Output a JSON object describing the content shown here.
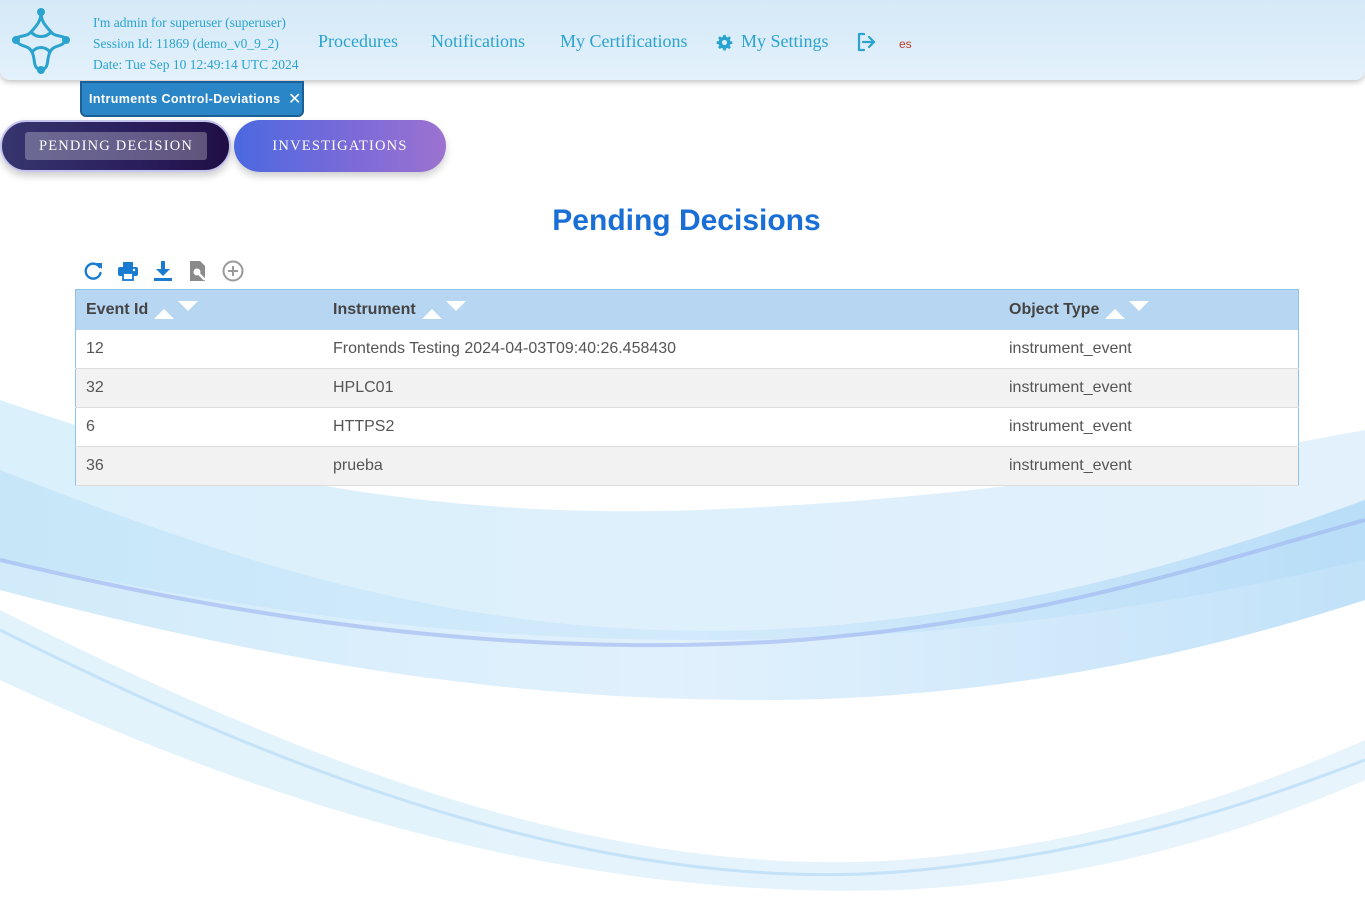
{
  "session": {
    "user_line": "I'm admin for superuser (superuser)",
    "session_line": "Session Id: 11869 (demo_v0_9_2)",
    "date_line": "Date: Tue Sep 10 12:49:14 UTC 2024"
  },
  "nav": {
    "procedures": "Procedures",
    "notifications": "Notifications",
    "certifications": "My Certifications",
    "settings": "My Settings",
    "language": "es"
  },
  "procedure_tab": {
    "label": "Intruments Control-Deviations",
    "close": "✕"
  },
  "view_tabs": {
    "pending": "PENDING DECISION",
    "investigations": "INVESTIGATIONS"
  },
  "page_title": "Pending Decisions",
  "toolbar": [
    "refresh-icon",
    "print-icon",
    "download-icon",
    "search-document-icon",
    "add-circle-icon"
  ],
  "table": {
    "headers": [
      "Event Id",
      "Instrument",
      "Object Type"
    ],
    "rows": [
      [
        "12",
        "Frontends Testing 2024-04-03T09:40:26.458430",
        "instrument_event"
      ],
      [
        "32",
        "HPLC01",
        "instrument_event"
      ],
      [
        "6",
        "HTTPS2",
        "instrument_event"
      ],
      [
        "36",
        "prueba",
        "instrument_event"
      ]
    ]
  },
  "colors": {
    "accent": "#2aa3cf",
    "title": "#1a6fd6",
    "header_bg": "#b7d6f2",
    "tab_bg": "#2b86c8",
    "language": "#c0392b"
  }
}
